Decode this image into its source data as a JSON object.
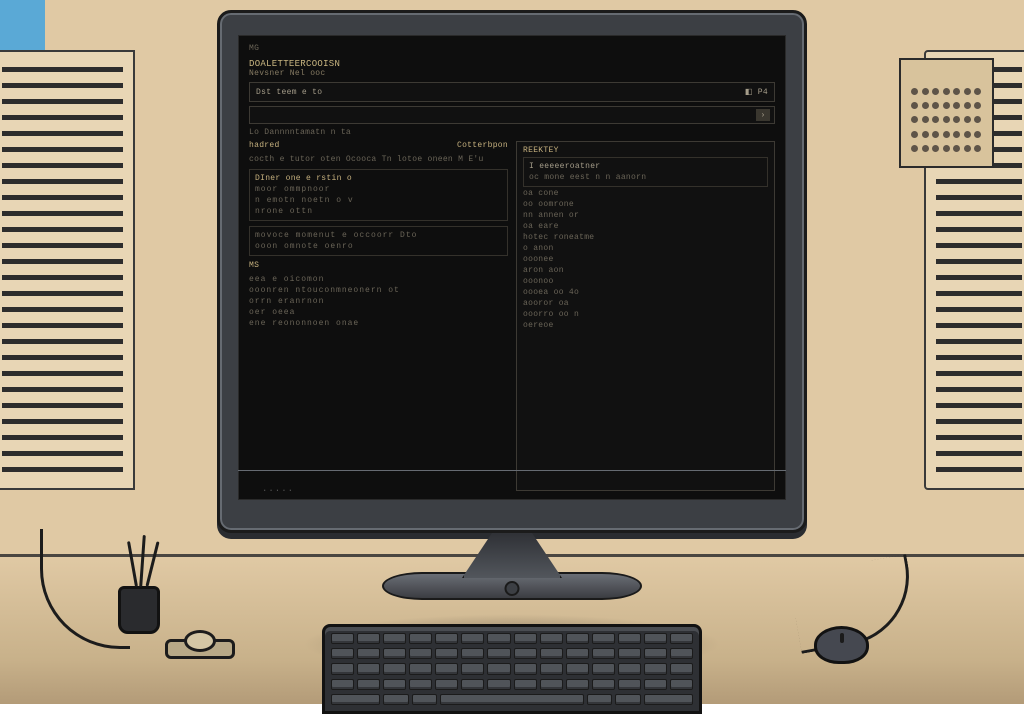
{
  "illustration": {
    "subject": "desktop-computer-on-desk",
    "style": "flat-cartoon",
    "palette": {
      "wall": "#e0c9a4",
      "screen_bg": "#0e0e0e",
      "text": "#a59d8a",
      "accent": "#c5b07e",
      "monitor": "#3c3f44"
    }
  },
  "screen": {
    "menubar": {
      "item": "MG"
    },
    "title": "DOALETTEERCOOISN",
    "subtitle": "Nevsner Nel ooc",
    "toolbar": {
      "left": "Dst teem e to",
      "right_icon": "◧",
      "right_label": "P4"
    },
    "search": {
      "value": ""
    },
    "status": "Lo Dannnntamatn n ta",
    "left_panel": {
      "header_left": "hadred",
      "header_right": "Cotterbpon",
      "line1": "cocth  e tutor oten Ocooca Tn lotoe oneen  M E'u",
      "block1": {
        "h": "DIner one e rstin o",
        "l1": "moor  ommpnoor",
        "l2": "n emotn    noetn o v",
        "l3": "nrone   ottn"
      },
      "block2": {
        "l1": "movoce momenut    e occoorr   Dto",
        "l2": "ooon omnote   oenro"
      },
      "ms": "MS",
      "tail": [
        "eea  e oicomon",
        "ooonren   ntouconmneonern  ot",
        "orrn eranrnon",
        "  oer oeea",
        "ene  reononnoen onae"
      ]
    },
    "right_panel": {
      "header": "REEKTEY",
      "block": {
        "h": "I eeeeeroatner",
        "sub": "oc mone eest   n  n aanorn"
      },
      "items": [
        "oa  cone",
        "oo  oomrone",
        "nn  annen or",
        "oa  eare",
        "hotec roneatme",
        "o anon",
        "ooonee",
        "aron aon",
        "ooonoo",
        "oooea oo 4o",
        "aooror oa",
        "ooorro oo n",
        "oereoe"
      ]
    }
  },
  "monitor": {
    "brand": "....."
  }
}
